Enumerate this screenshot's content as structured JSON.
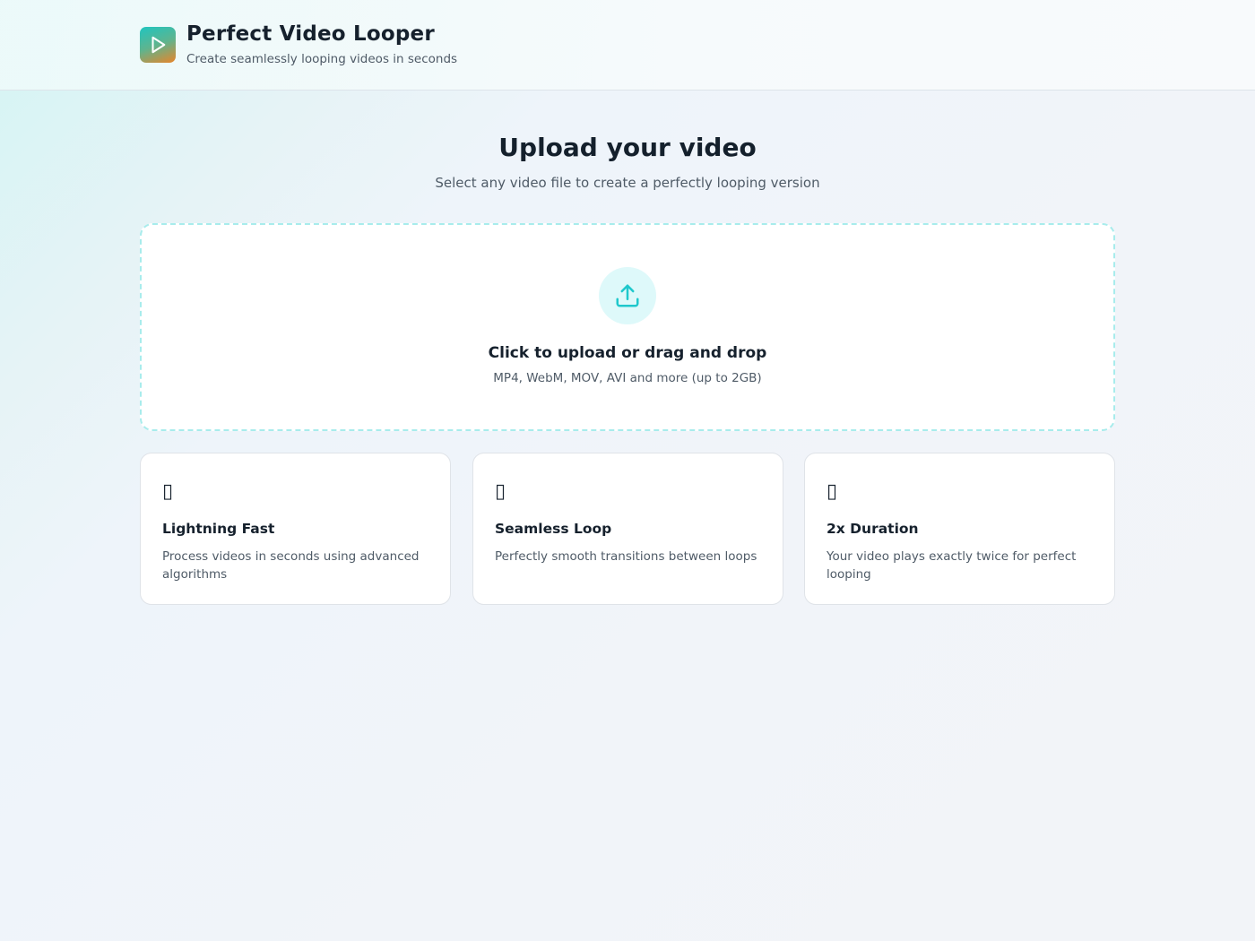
{
  "header": {
    "title": "Perfect Video Looper",
    "subtitle": "Create seamlessly looping videos in seconds",
    "logo_icon": "play-icon"
  },
  "main": {
    "heading": "Upload your video",
    "subheading": "Select any video file to create a perfectly looping version"
  },
  "dropzone": {
    "icon": "upload-icon",
    "title": "Click to upload or drag and drop",
    "hint": "MP4, WebM, MOV, AVI and more (up to 2GB)"
  },
  "features": [
    {
      "icon": "missing-glyph-icon",
      "glyph": "▯",
      "title": "Lightning Fast",
      "description": "Process videos in seconds using advanced algorithms"
    },
    {
      "icon": "missing-glyph-icon",
      "glyph": "▯",
      "title": "Seamless Loop",
      "description": "Perfectly smooth transitions between loops"
    },
    {
      "icon": "missing-glyph-icon",
      "glyph": "▯",
      "title": "2x Duration",
      "description": "Your video plays exactly twice for perfect looping"
    }
  ],
  "colors": {
    "accent": "#1fc8cc",
    "logo_gradient_start": "#20c5c0",
    "logo_gradient_end": "#e8852a",
    "text_primary": "#16212d",
    "text_secondary": "#4f5b67"
  }
}
